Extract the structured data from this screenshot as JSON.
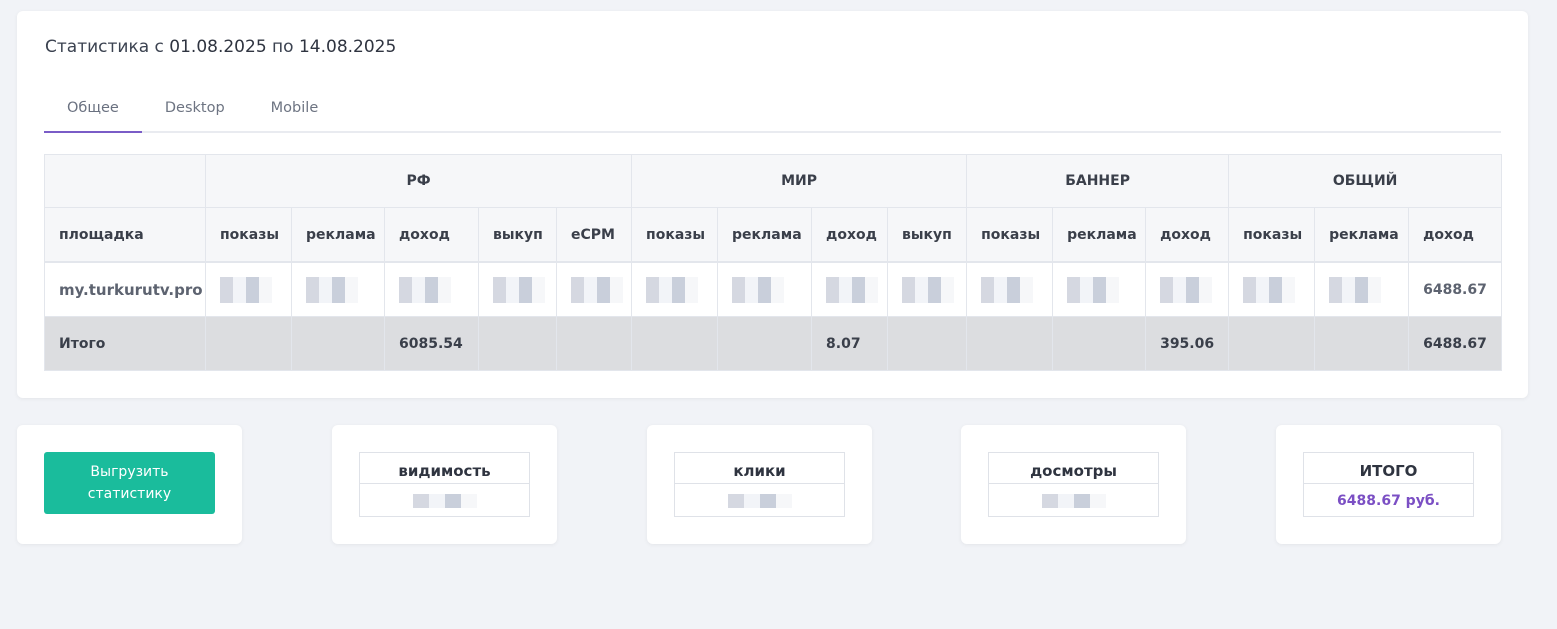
{
  "header": {
    "title_prefix": "Статистика с",
    "date_from": "01.08.2025",
    "by": "по",
    "date_to": "14.08.2025"
  },
  "tabs": [
    {
      "label": "Общее",
      "active": true
    },
    {
      "label": "Desktop",
      "active": false
    },
    {
      "label": "Mobile",
      "active": false
    }
  ],
  "table": {
    "groups": [
      "РФ",
      "МИР",
      "БАННЕР",
      "ОБЩИЙ"
    ],
    "site_header": "площадка",
    "columns": {
      "rf": [
        "показы",
        "реклама",
        "доход",
        "выкуп",
        "eCPM"
      ],
      "mir": [
        "показы",
        "реклама",
        "доход",
        "выкуп"
      ],
      "banner": [
        "показы",
        "реклама",
        "доход"
      ],
      "total": [
        "показы",
        "реклама",
        "доход"
      ]
    },
    "row": {
      "site": "my.turkurutv.pro",
      "total_income": "6488.67"
    },
    "totals": {
      "label": "Итого",
      "rf_income": "6085.54",
      "mir_income": "8.07",
      "banner_income": "395.06",
      "total_income": "6488.67"
    }
  },
  "summary": {
    "export_label": "Выгрузить статистику",
    "visibility_label": "видимость",
    "clicks_label": "клики",
    "views_label": "досмотры",
    "total_label": "ИТОГО",
    "total_value": "6488.67 руб."
  },
  "colors": {
    "accent": "#7a5cc7",
    "button": "#1abc9c",
    "total_value": "#7b4fc4"
  }
}
